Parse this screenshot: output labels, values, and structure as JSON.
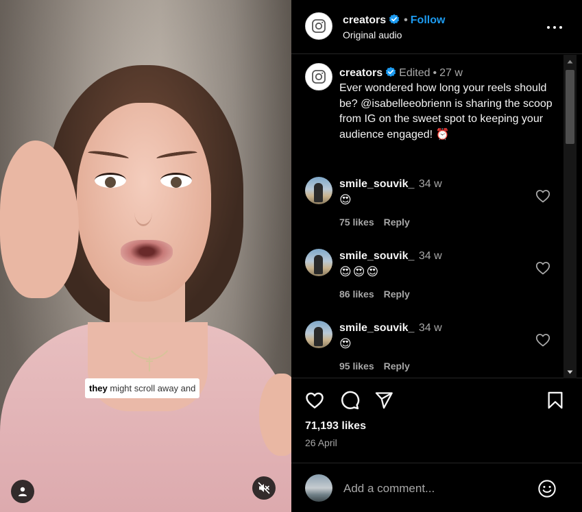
{
  "video": {
    "caption_bold": "they",
    "caption_rest": " might scroll away and",
    "user_icon": "person-icon",
    "mute_icon": "speaker-muted-icon"
  },
  "header": {
    "username": "creators",
    "verified": true,
    "separator": "•",
    "follow_label": "Follow",
    "subtitle": "Original audio",
    "more_icon": "more-horizontal-icon"
  },
  "caption": {
    "username": "creators",
    "edited": "Edited",
    "separator": "•",
    "age": "27 w",
    "text": "Ever wondered how long your reels should be? @isabelleeobrienn is sharing the scoop from IG on the sweet spot to keeping your audience engaged! ⏰"
  },
  "comments": [
    {
      "username": "smile_souvik_",
      "age": "34 w",
      "text": "😍",
      "likes": "75 likes",
      "reply": "Reply"
    },
    {
      "username": "smile_souvik_",
      "age": "34 w",
      "text": "😍😍😍",
      "likes": "86 likes",
      "reply": "Reply"
    },
    {
      "username": "smile_souvik_",
      "age": "34 w",
      "text": "😍",
      "likes": "95 likes",
      "reply": "Reply"
    }
  ],
  "actions": {
    "like_icon": "heart-icon",
    "comment_icon": "comment-icon",
    "share_icon": "send-icon",
    "save_icon": "bookmark-icon"
  },
  "likes_count": "71,193 likes",
  "post_date": "26 April",
  "add_comment": {
    "placeholder": "Add a comment...",
    "emoji_icon": "smiley-icon"
  },
  "colors": {
    "background": "#000000",
    "text": "#f5f5f5",
    "muted": "#a8a8a8",
    "link_blue": "#1d9bf0",
    "verified_blue": "#1d9bf0",
    "divider": "#262626"
  }
}
